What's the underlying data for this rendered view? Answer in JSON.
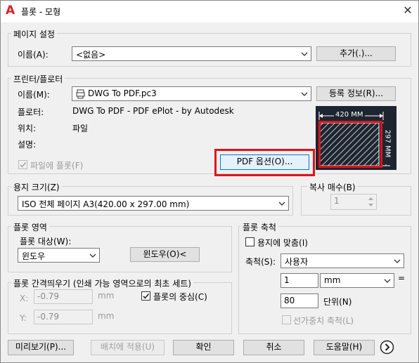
{
  "window": {
    "title": "플롯 - 모형",
    "app_icon": "A"
  },
  "page_setup": {
    "group": "페이지 설정",
    "name_label": "이름(A):",
    "name_value": "<없음>",
    "add_button": "추가(.)..."
  },
  "printer": {
    "group": "프린터/플로터",
    "name_label": "이름(M):",
    "name_value": "DWG To PDF.pc3",
    "properties_button": "등록 정보(R)...",
    "plotter_label": "플로터:",
    "plotter_value": "DWG To PDF - PDF ePlot - by Autodesk",
    "where_label": "위치:",
    "where_value": "파일",
    "desc_label": "설명:",
    "plot_to_file": "파일에 플롯(F)",
    "pdf_options_button": "PDF 옵션(O)...",
    "preview_width": "420 MM",
    "preview_height": "297 MM"
  },
  "paper_size": {
    "group": "용지 크기(Z)",
    "value": "ISO 전체 페이지 A3(420.00 x 297.00 mm)"
  },
  "copies": {
    "group": "복사 매수(B)",
    "value": "1"
  },
  "plot_area": {
    "group": "플롯 영역",
    "what_label": "플롯 대상(W):",
    "what_value": "윈도우",
    "window_button": "윈도우(O)<"
  },
  "plot_scale": {
    "group": "플롯 축척",
    "fit_paper": "용지에 맞춤(I)",
    "scale_label": "축척(S):",
    "scale_value": "사용자",
    "value1": "1",
    "unit1": "mm",
    "equals": "=",
    "value2": "80",
    "unit2": "단위(N)",
    "scale_lineweights": "선가중치 축척(L)"
  },
  "plot_offset": {
    "group": "플롯 간격띄우기 (인쇄 가능 영역으로의 최초 세트)",
    "x_label": "X:",
    "x_value": "-0.79",
    "x_unit": "mm",
    "y_label": "Y:",
    "y_value": "-0.79",
    "y_unit": "mm",
    "center": "플롯의 중심(C)"
  },
  "footer": {
    "preview": "미리보기(P)...",
    "apply_layout": "배치에 적용(U)",
    "ok": "확인",
    "cancel": "취소",
    "help": "도움말(H)"
  }
}
